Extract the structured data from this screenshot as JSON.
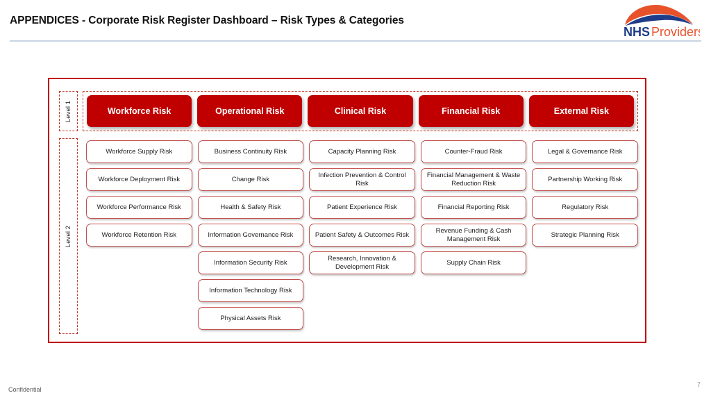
{
  "header": {
    "title": "APPENDICES - Corporate Risk Register Dashboard – Risk Types & Categories",
    "logo": {
      "name": "nhs-providers-logo",
      "text_primary": "NHS",
      "text_secondary": "Providers",
      "arc_color": "#E8522B",
      "wave_color": "#1F3C88",
      "primary_text_color": "#1F3C88",
      "secondary_text_color": "#E8522B"
    },
    "rule_color": "#c8d4e4"
  },
  "diagram": {
    "frame_color": "#C00000",
    "level1_color": "#C00000",
    "level2_border_color": "#C0504D",
    "levels": [
      {
        "label": "Level 1",
        "boxes": [
          "Workforce Risk",
          "Operational Risk",
          "Clinical Risk",
          "Financial Risk",
          "External Risk"
        ]
      },
      {
        "label": "Level 2",
        "columns": [
          {
            "parent": "Workforce Risk",
            "items": [
              "Workforce Supply Risk",
              "Workforce Deployment Risk",
              "Workforce Performance Risk",
              "Workforce Retention Risk"
            ]
          },
          {
            "parent": "Operational Risk",
            "items": [
              "Business Continuity Risk",
              "Change Risk",
              "Health & Safety Risk",
              "Information Governance Risk",
              "Information Security Risk",
              "Information Technology Risk",
              "Physical Assets Risk"
            ]
          },
          {
            "parent": "Clinical Risk",
            "items": [
              "Capacity Planning Risk",
              "Infection Prevention & Control Risk",
              "Patient Experience Risk",
              "Patient Safety & Outcomes Risk",
              "Research, Innovation & Development Risk"
            ]
          },
          {
            "parent": "Financial Risk",
            "items": [
              "Counter-Fraud Risk",
              "Financial Management & Waste Reduction Risk",
              "Financial Reporting Risk",
              "Revenue Funding & Cash Management Risk",
              "Supply Chain Risk"
            ]
          },
          {
            "parent": "External Risk",
            "items": [
              "Legal & Governance Risk",
              "Partnership Working Risk",
              "Regulatory Risk",
              "Strategic Planning Risk"
            ]
          }
        ]
      }
    ]
  },
  "footer": {
    "confidential": "Confidential",
    "page_number": "7"
  }
}
